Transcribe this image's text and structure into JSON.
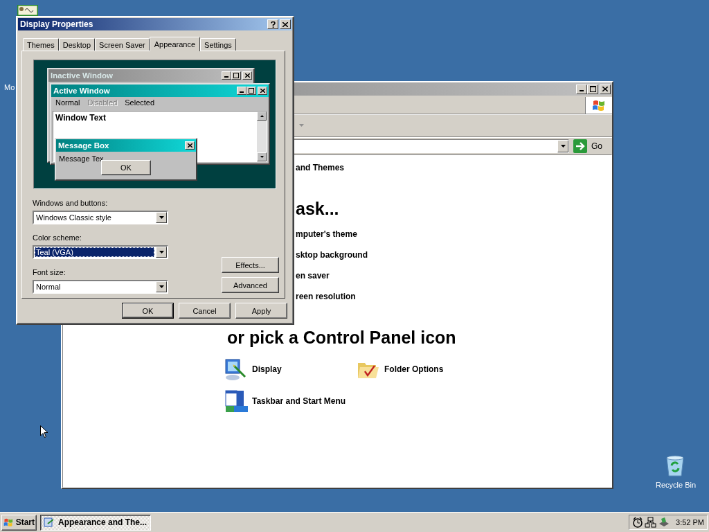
{
  "desktop": {
    "icons": [
      {
        "label": "Mo"
      },
      {
        "label": "Recycle Bin"
      }
    ]
  },
  "control_panel_window": {
    "address_button": "Go",
    "category_link": "and Themes",
    "task_heading": "ask...",
    "tasks": [
      "mputer's theme",
      "sktop background",
      "en saver",
      "reen resolution"
    ],
    "icon_heading": "or pick a Control Panel icon",
    "icons": [
      {
        "kind": "display",
        "label": "Display"
      },
      {
        "kind": "folder",
        "label": "Folder Options"
      },
      {
        "kind": "taskbar",
        "label": "Taskbar and Start Menu"
      }
    ]
  },
  "dialog": {
    "title": "Display Properties",
    "tabs": [
      {
        "label": "Themes",
        "selected": false
      },
      {
        "label": "Desktop",
        "selected": false
      },
      {
        "label": "Screen Saver",
        "selected": false
      },
      {
        "label": "Appearance",
        "selected": true
      },
      {
        "label": "Settings",
        "selected": false
      }
    ],
    "preview": {
      "inactive_title": "Inactive Window",
      "active_title": "Active Window",
      "menu": [
        {
          "label": "Normal",
          "disabled": false
        },
        {
          "label": "Disabled",
          "disabled": true
        },
        {
          "label": "Selected",
          "disabled": false
        }
      ],
      "window_text": "Window Text",
      "message_title": "Message Box",
      "message_text": "Message Tex",
      "message_button": "OK"
    },
    "fields": [
      {
        "label": "Windows and buttons:",
        "value": "Windows Classic style",
        "focused": false
      },
      {
        "label": "Color scheme:",
        "value": "Teal (VGA)",
        "focused": true
      },
      {
        "label": "Font size:",
        "value": "Normal",
        "focused": false
      }
    ],
    "side_buttons": [
      "Effects...",
      "Advanced"
    ],
    "buttons": [
      {
        "label": "OK",
        "default": true
      },
      {
        "label": "Cancel",
        "default": false
      },
      {
        "label": "Apply",
        "default": false
      }
    ]
  },
  "taskbar": {
    "start": "Start",
    "tasks": [
      {
        "label": "Appearance and The...",
        "selected": true
      }
    ],
    "clock": "3:52 PM"
  }
}
